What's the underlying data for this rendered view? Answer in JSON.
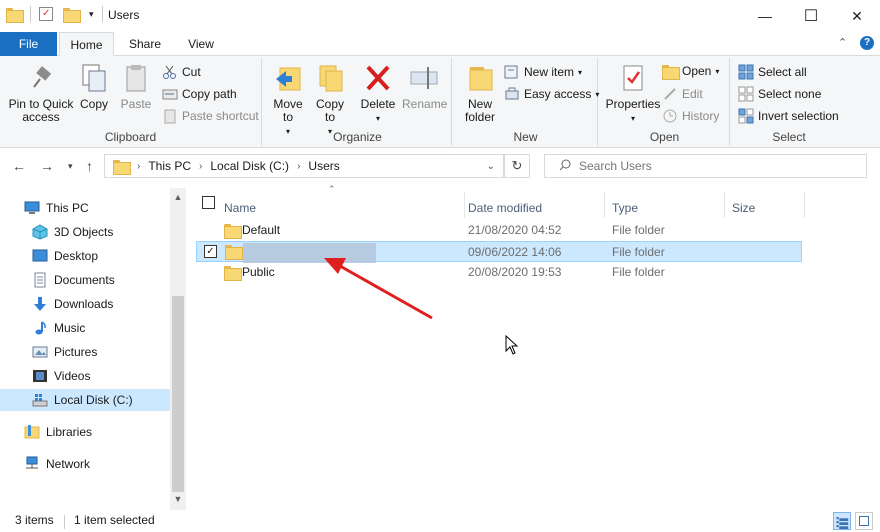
{
  "window": {
    "title": "Users",
    "minimize": "—",
    "maximize": "☐",
    "close": "✕"
  },
  "tabs": {
    "file": "File",
    "home": "Home",
    "share": "Share",
    "view": "View"
  },
  "ribbon": {
    "clipboard": {
      "label": "Clipboard",
      "pin": "Pin to Quick access",
      "copy": "Copy",
      "paste": "Paste",
      "cut": "Cut",
      "copy_path": "Copy path",
      "paste_shortcut": "Paste shortcut"
    },
    "organize": {
      "label": "Organize",
      "move_to": "Move to",
      "copy_to": "Copy to",
      "delete": "Delete",
      "rename": "Rename"
    },
    "new": {
      "label": "New",
      "new_folder": "New folder",
      "new_item": "New item",
      "easy_access": "Easy access"
    },
    "open": {
      "label": "Open",
      "properties": "Properties",
      "open": "Open",
      "edit": "Edit",
      "history": "History"
    },
    "select": {
      "label": "Select",
      "select_all": "Select all",
      "select_none": "Select none",
      "invert_selection": "Invert selection"
    }
  },
  "address": {
    "crumbs": [
      "This PC",
      "Local Disk (C:)",
      "Users"
    ],
    "search_placeholder": "Search Users"
  },
  "nav": {
    "items": [
      {
        "label": "This PC",
        "icon": "pc-icon"
      },
      {
        "label": "3D Objects",
        "icon": "cube-icon"
      },
      {
        "label": "Desktop",
        "icon": "desktop-icon"
      },
      {
        "label": "Documents",
        "icon": "documents-icon"
      },
      {
        "label": "Downloads",
        "icon": "download-icon"
      },
      {
        "label": "Music",
        "icon": "music-icon"
      },
      {
        "label": "Pictures",
        "icon": "pictures-icon"
      },
      {
        "label": "Videos",
        "icon": "videos-icon"
      },
      {
        "label": "Local Disk (C:)",
        "icon": "drive-icon",
        "selected": true
      },
      {
        "label": "Libraries",
        "icon": "libraries-icon"
      },
      {
        "label": "Network",
        "icon": "network-icon"
      }
    ]
  },
  "columns": {
    "name": "Name",
    "date": "Date modified",
    "type": "Type",
    "size": "Size"
  },
  "files": [
    {
      "name": "Default",
      "date": "21/08/2020 04:52",
      "type": "File folder",
      "selected": false
    },
    {
      "name": "",
      "date": "09/06/2022 14:06",
      "type": "File folder",
      "selected": true
    },
    {
      "name": "Public",
      "date": "20/08/2020 19:53",
      "type": "File folder",
      "selected": false
    }
  ],
  "status": {
    "items": "3 items",
    "selected": "1 item selected"
  },
  "colors": {
    "accent": "#1a6fc2",
    "selection": "#cce8ff",
    "annotation_arrow": "#e02020"
  }
}
